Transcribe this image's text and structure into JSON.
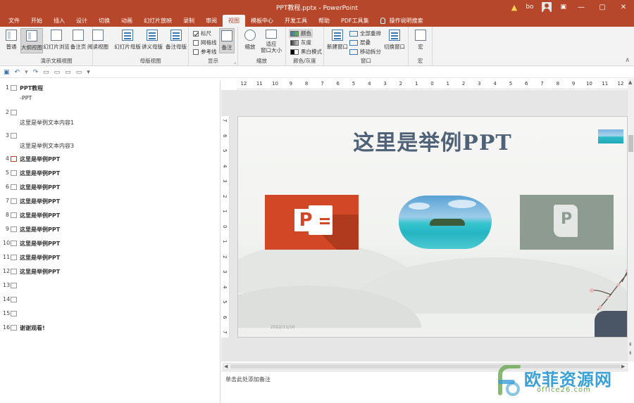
{
  "titlebar": {
    "title": "PPT教程.pptx  -  PowerPoint",
    "warning_icon": "warning-icon",
    "user": "bo",
    "minimize": "—",
    "restore": "▢",
    "close": "✕"
  },
  "tabs": [
    "文件",
    "开始",
    "插入",
    "设计",
    "切换",
    "动画",
    "幻灯片放映",
    "录制",
    "审阅",
    "视图",
    "模板中心",
    "开发工具",
    "帮助",
    "PDF工具集"
  ],
  "active_tab": "视图",
  "tell_me": "操作说明搜索",
  "ribbon": {
    "presentation_views": {
      "label": "演示文稿视图",
      "buttons": [
        "普通",
        "大纲视图",
        "幻灯片浏览",
        "备注页",
        "阅读视图"
      ],
      "selected": "大纲视图"
    },
    "master_views": {
      "label": "母版视图",
      "buttons": [
        "幻灯片母版",
        "讲义母版",
        "备注母版"
      ]
    },
    "show": {
      "label": "显示",
      "checks": [
        {
          "label": "标尺",
          "checked": true
        },
        {
          "label": "网格线",
          "checked": false
        },
        {
          "label": "参考线",
          "checked": false
        }
      ],
      "notes": "备注"
    },
    "zoom": {
      "label": "缩放",
      "zoom": "缩放",
      "fit": "适应\n窗口大小"
    },
    "color": {
      "label": "颜色/灰度",
      "options": [
        "颜色",
        "灰度",
        "黑白模式"
      ],
      "selected": "颜色"
    },
    "window": {
      "label": "窗口",
      "new_window": "新建窗口",
      "items": [
        "全部重排",
        "层叠",
        "移动拆分"
      ],
      "switch": "切换窗口"
    },
    "macros": {
      "label": "宏",
      "macro": "宏"
    }
  },
  "outline": [
    {
      "num": "1",
      "text": "PPT教程",
      "bold": true,
      "sub": "-PPT"
    },
    {
      "num": "2",
      "text": "",
      "bold": false,
      "sub": "这里是举例文本内容1"
    },
    {
      "num": "3",
      "text": "",
      "bold": false,
      "sub": "这里是举例文本内容3"
    },
    {
      "num": "4",
      "text": "这里是举例PPT",
      "bold": true,
      "selected": true
    },
    {
      "num": "5",
      "text": "这里是举例PPT",
      "bold": true
    },
    {
      "num": "6",
      "text": "这里是举例PPT",
      "bold": true
    },
    {
      "num": "7",
      "text": "这里是举例PPT",
      "bold": true
    },
    {
      "num": "8",
      "text": "这里是举例PPT",
      "bold": true
    },
    {
      "num": "9",
      "text": "这里是举例PPT",
      "bold": true
    },
    {
      "num": "10",
      "text": "这里是举例PPT",
      "bold": true
    },
    {
      "num": "11",
      "text": "这里是举例PPT",
      "bold": true
    },
    {
      "num": "12",
      "text": "这里是举例PPT",
      "bold": true
    },
    {
      "num": "13",
      "text": "",
      "bold": false
    },
    {
      "num": "14",
      "text": "",
      "bold": false
    },
    {
      "num": "15",
      "text": "",
      "bold": false
    },
    {
      "num": "16",
      "text": "谢谢观看!",
      "bold": true
    }
  ],
  "hruler": [
    "12",
    "11",
    "10",
    "9",
    "8",
    "7",
    "6",
    "5",
    "4",
    "3",
    "2",
    "1",
    "0",
    "1",
    "2",
    "3",
    "4",
    "5",
    "6",
    "7",
    "8",
    "9",
    "10",
    "11",
    "12"
  ],
  "vruler": [
    "7",
    "6",
    "5",
    "4",
    "3",
    "2",
    "1",
    "0",
    "1",
    "2",
    "3",
    "4",
    "5",
    "6",
    "7"
  ],
  "slide": {
    "title": "这里是举例PPT",
    "date": "2022/11/10"
  },
  "notes_placeholder": "单击此处添加备注",
  "watermark": {
    "cn": "欧菲资源网",
    "en": "office26.com"
  }
}
